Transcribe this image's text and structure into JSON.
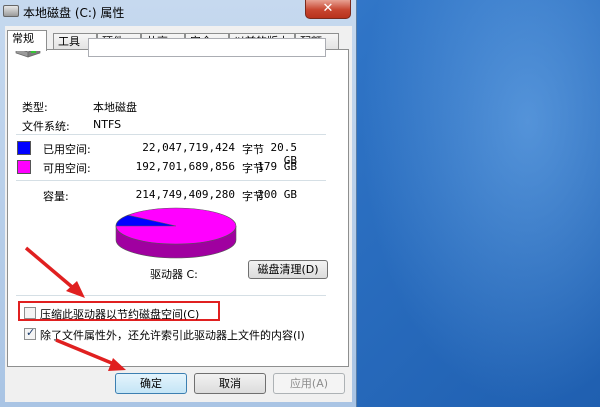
{
  "window": {
    "title": "本地磁盘 (C:) 属性",
    "close_label": "✕"
  },
  "tabs": [
    {
      "label": "常规",
      "active": true
    },
    {
      "label": "工具"
    },
    {
      "label": "硬件"
    },
    {
      "label": "共享"
    },
    {
      "label": "安全"
    },
    {
      "label": "以前的版本"
    },
    {
      "label": "配额"
    }
  ],
  "general": {
    "name_value": "",
    "type_label": "类型:",
    "type_value": "本地磁盘",
    "fs_label": "文件系统:",
    "fs_value": "NTFS",
    "used": {
      "label": "已用空间:",
      "bytes": "22,047,719,424",
      "unit": "字节",
      "size": "20.5 GB",
      "color": "#0000ff"
    },
    "free": {
      "label": "可用空间:",
      "bytes": "192,701,689,856",
      "unit": "字节",
      "size": "179 GB",
      "color": "#ff00ff"
    },
    "capacity": {
      "label": "容量:",
      "bytes": "214,749,409,280",
      "unit": "字节",
      "size": "200 GB"
    },
    "drive_label": "驱动器 C:",
    "cleanup_button": "磁盘清理(D)",
    "compress_label": "压缩此驱动器以节约磁盘空间(C)",
    "compress_checked": false,
    "index_label": "除了文件属性外，还允许索引此驱动器上文件的内容(I)",
    "index_checked": true
  },
  "buttons": {
    "ok": "确定",
    "cancel": "取消",
    "apply": "应用(A)"
  },
  "colors": {
    "used": "#0000ff",
    "free": "#ff00ff",
    "highlight": "#e02020",
    "arrow": "#e02020"
  }
}
